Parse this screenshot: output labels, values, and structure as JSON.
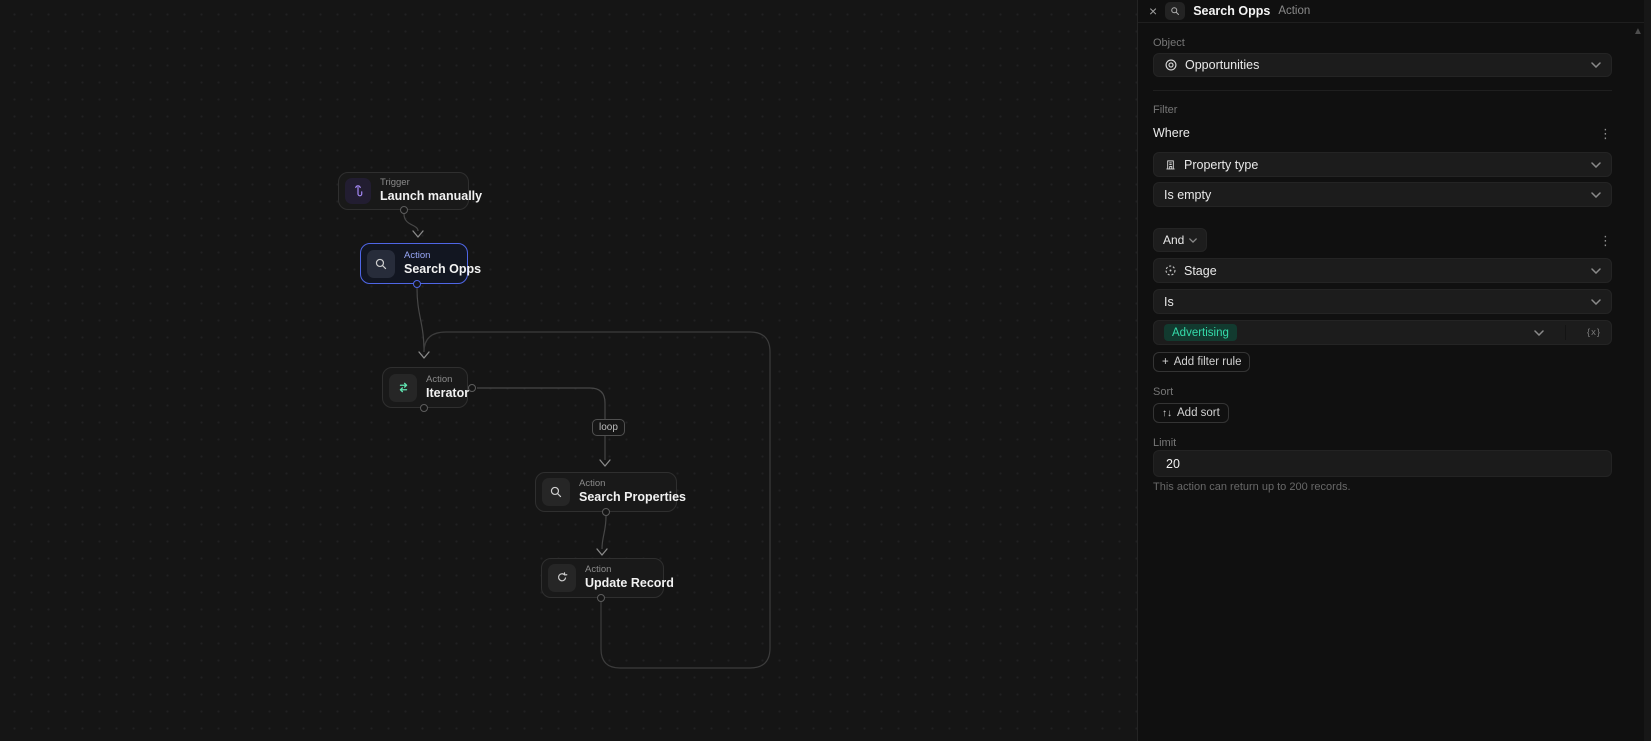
{
  "canvas": {
    "loop_badge": "loop",
    "nodes": [
      {
        "id": "trigger",
        "type_label": "Trigger",
        "title": "Launch manually",
        "icon": "tap-icon"
      },
      {
        "id": "search-opps",
        "type_label": "Action",
        "title": "Search Opps",
        "icon": "search-icon",
        "selected": true
      },
      {
        "id": "iterator",
        "type_label": "Action",
        "title": "Iterator",
        "icon": "loop-icon"
      },
      {
        "id": "search-properties",
        "type_label": "Action",
        "title": "Search Properties",
        "icon": "search-icon"
      },
      {
        "id": "update-record",
        "type_label": "Action",
        "title": "Update Record",
        "icon": "refresh-icon"
      }
    ]
  },
  "panel": {
    "header": {
      "title": "Search Opps",
      "badge": "Action",
      "close_icon": "×"
    },
    "object_section": {
      "label": "Object",
      "value": "Opportunities"
    },
    "filter_section": {
      "label": "Filter",
      "where_label": "Where",
      "rules": [
        {
          "attribute": "Property type",
          "operator": "Is empty"
        },
        {
          "conjunction": "And",
          "attribute": "Stage",
          "operator": "Is",
          "value": "Advertising"
        }
      ],
      "variable_icon_label": "{x}",
      "add_filter_label": "Add filter rule",
      "plus_glyph": "+"
    },
    "sort_section": {
      "label": "Sort",
      "add_sort_label": "Add sort",
      "updown_glyph": "↑↓"
    },
    "limit_section": {
      "label": "Limit",
      "value": "20",
      "helper": "This action can return up to 200 records."
    },
    "kebab_glyph": "⋮",
    "scroll_up_glyph": "▲"
  },
  "colors": {
    "canvas_bg": "#151515",
    "panel_bg": "#101010",
    "selection_blue": "#4f66e6",
    "trigger_purple": "#a78bfa",
    "iterator_green": "#5fe3b0",
    "value_teal": "#35dcab",
    "value_teal_bg": "#123a2f"
  }
}
